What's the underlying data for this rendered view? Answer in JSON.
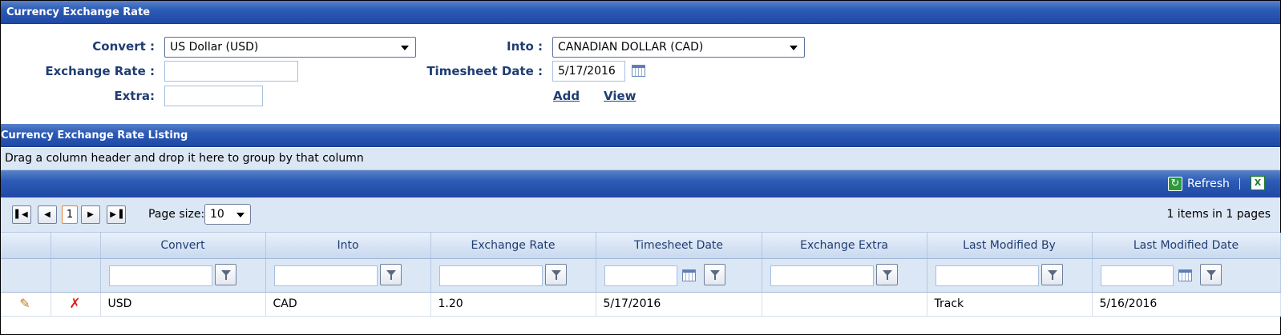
{
  "form": {
    "title": "Currency Exchange Rate",
    "convert_label": "Convert :",
    "convert_value": "US Dollar (USD)",
    "into_label": "Into :",
    "into_value": "CANADIAN DOLLAR (CAD)",
    "exchange_rate_label": "Exchange Rate :",
    "exchange_rate_value": "",
    "timesheet_date_label": "Timesheet Date :",
    "timesheet_date_value": "5/17/2016",
    "extra_label": "Extra:",
    "extra_value": "",
    "add_link": "Add",
    "view_link": "View"
  },
  "listing": {
    "title": "Currency Exchange Rate Listing",
    "group_hint": "Drag a column header and drop it here to group by that column",
    "toolbar": {
      "refresh_label": "Refresh",
      "refresh_icon": "refresh-icon",
      "export_icon": "excel-export-icon"
    },
    "pager": {
      "first_icon": "first-page-icon",
      "prev_icon": "previous-page-icon",
      "current_page": "1",
      "next_icon": "next-page-icon",
      "last_icon": "last-page-icon",
      "page_size_label": "Page size:",
      "page_size_value": "10",
      "info": "1 items in 1 pages"
    },
    "columns": [
      "",
      "",
      "Convert",
      "Into",
      "Exchange Rate",
      "Timesheet Date",
      "Exchange Extra",
      "Last Modified By",
      "Last Modified Date"
    ],
    "rows": [
      {
        "edit_icon": "edit-pencil-icon",
        "delete_icon": "delete-x-icon",
        "convert": "USD",
        "into": "CAD",
        "exchange_rate": "1.20",
        "timesheet_date": "5/17/2016",
        "exchange_extra": "",
        "last_modified_by": "Track",
        "last_modified_date": "5/16/2016"
      }
    ]
  },
  "colors": {
    "header_blue": "#2c5bb5",
    "panel_light_blue": "#dce7f5",
    "label_navy": "#1f3d73"
  }
}
